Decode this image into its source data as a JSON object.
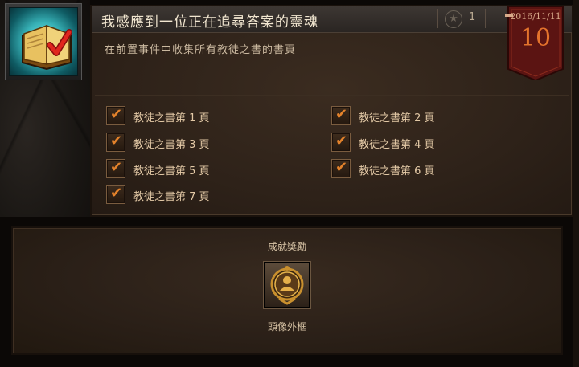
{
  "achievement": {
    "title": "我感應到一位正在追尋答案的靈魂",
    "points": "1",
    "description": "在前置事件中收集所有教徒之書的書頁",
    "icon": "golden-book-check-icon"
  },
  "completion_banner": {
    "date": "2016/11/11",
    "day": "10"
  },
  "criteria": [
    {
      "label": "教徒之書第 1 頁",
      "checked": true
    },
    {
      "label": "教徒之書第 2 頁",
      "checked": true
    },
    {
      "label": "教徒之書第 3 頁",
      "checked": true
    },
    {
      "label": "教徒之書第 4 頁",
      "checked": true
    },
    {
      "label": "教徒之書第 5 頁",
      "checked": true
    },
    {
      "label": "教徒之書第 6 頁",
      "checked": true
    },
    {
      "label": "教徒之書第 7 頁",
      "checked": true
    }
  ],
  "reward": {
    "heading": "成就獎勵",
    "name": "頭像外框",
    "icon": "portrait-frame-icon"
  },
  "colors": {
    "accent": "#e3822b",
    "banner_red": "#5b1412",
    "icon_teal": "#38b3b8"
  },
  "check_glyph": "✔"
}
